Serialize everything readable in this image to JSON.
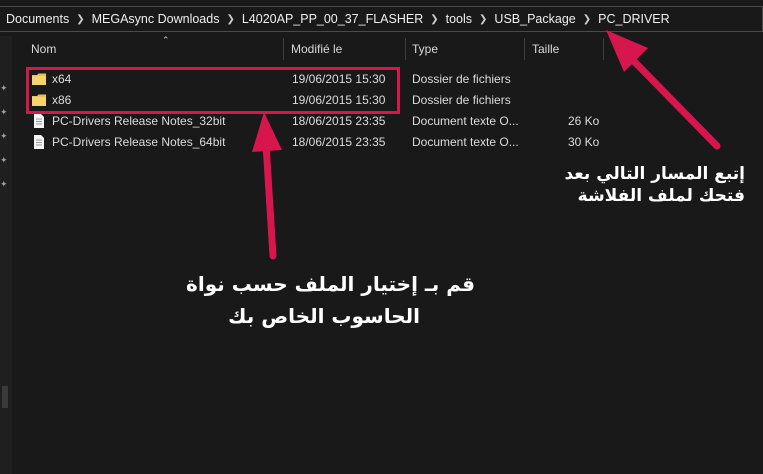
{
  "breadcrumb": [
    "Documents",
    "MEGAsync Downloads",
    "L4020AP_PP_00_37_FLASHER",
    "tools",
    "USB_Package",
    "PC_DRIVER"
  ],
  "columns": {
    "name": "Nom",
    "modified": "Modifié le",
    "type": "Type",
    "size": "Taille"
  },
  "files": [
    {
      "name": "x64",
      "modified": "19/06/2015 15:30",
      "type": "Dossier de fichiers",
      "size": "",
      "icon": "folder-icon"
    },
    {
      "name": "x86",
      "modified": "19/06/2015 15:30",
      "type": "Dossier de fichiers",
      "size": "",
      "icon": "folder-icon"
    },
    {
      "name": "PC-Drivers Release Notes_32bit",
      "modified": "18/06/2015 23:35",
      "type": "Document texte O...",
      "size": "26 Ko",
      "icon": "text-document-icon"
    },
    {
      "name": "PC-Drivers Release Notes_64bit",
      "modified": "18/06/2015 23:35",
      "type": "Document texte O...",
      "size": "30 Ko",
      "icon": "text-document-icon"
    }
  ],
  "annotations": {
    "path_note_line1": "إتبع المسار التالي بعد",
    "path_note_line2": "فتحك لملف الفلاشة",
    "folder_note_line1": "قم بـ إختيار الملف حسب نواة",
    "folder_note_line2": "الحاسوب الخاص بك"
  },
  "colors": {
    "accent": "#d7164e",
    "background": "#191919"
  }
}
